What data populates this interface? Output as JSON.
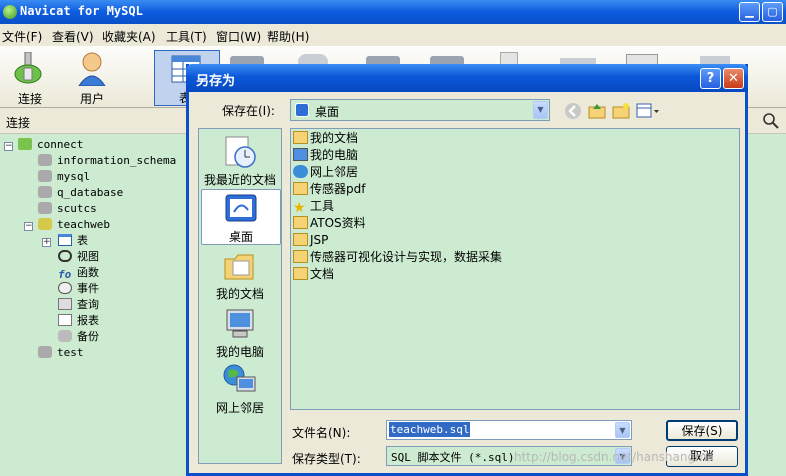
{
  "app": {
    "title": "Navicat for MySQL",
    "menus": [
      "文件(F)",
      "查看(V)",
      "收藏夹(A)",
      "工具(T)",
      "窗口(W)",
      "帮助(H)"
    ],
    "toolbar": {
      "connect_label": "连接",
      "user_label": "用户",
      "table_label": "表"
    },
    "connection_header": "连接",
    "tree": {
      "connection": "connect",
      "databases": [
        "information_schema",
        "mysql",
        "q_database",
        "scutcs",
        "teachweb",
        "test"
      ],
      "teachweb_children": [
        "表",
        "视图",
        "函数",
        "事件",
        "查询",
        "报表",
        "备份"
      ]
    }
  },
  "dialog": {
    "title": "另存为",
    "help_btn": "?",
    "close_btn": "✕",
    "save_in_label": "保存在(I):",
    "save_in_value": "桌面",
    "places": [
      "我最近的文档",
      "桌面",
      "我的文档",
      "我的电脑",
      "网上邻居"
    ],
    "files": [
      "我的文档",
      "我的电脑",
      "网上邻居",
      "传感器pdf",
      "工具",
      "ATOS资料",
      "JSP",
      "传感器可视化设计与实现，数据采集",
      "文档"
    ],
    "filename_label": "文件名(N):",
    "filename_value": "teachweb.sql",
    "filetype_label": "保存类型(T):",
    "filetype_value": "SQL 脚本文件 (*.sql)",
    "save_button": "保存(S)",
    "cancel_button": "取消",
    "watermark": "http://blog.csdn.net/hanshangma"
  }
}
